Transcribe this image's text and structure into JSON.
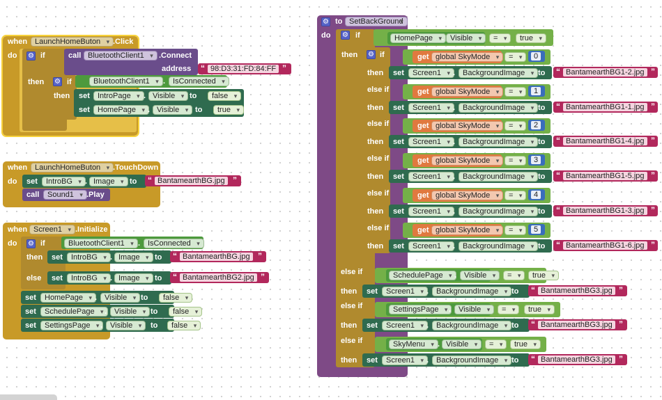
{
  "kw": {
    "when": "when",
    "do": "do",
    "if": "if",
    "then": "then",
    "else": "else",
    "else_if": "else if",
    "set": "set",
    "call": "call",
    "get": "get",
    "to": "to",
    "eq": "=",
    "dot_click": ".Click",
    "dot_touchdown": ".TouchDown",
    "dot_initialize": ".Initialize",
    "dot_connect": ".Connect",
    "dot_play": ".Play",
    "address": "address",
    "quote_open": "“",
    "quote_close": "”",
    "dot": "."
  },
  "blocks": {
    "launch_click": {
      "component": "LaunchHomeButon",
      "call_component": "BluetoothClient1",
      "address_value": "98:D3:31:FD:84:FF",
      "inner_component": "BluetoothClient1",
      "inner_prop": "IsConnected",
      "set1_component": "IntroPage",
      "set1_prop": "Visible",
      "set1_value": "false",
      "set2_component": "HomePage",
      "set2_prop": "Visible",
      "set2_value": "true"
    },
    "launch_touchdown": {
      "component": "LaunchHomeButon",
      "set_component": "IntroBG",
      "set_prop": "Image",
      "set_value": "BantamearthBG.jpg",
      "call_component": "Sound1"
    },
    "screen_init": {
      "component": "Screen1",
      "if_component": "BluetoothClient1",
      "if_prop": "IsConnected",
      "then_component": "IntroBG",
      "then_prop": "Image",
      "then_value": "BantamearthBG.jpg",
      "else_component": "IntroBG",
      "else_prop": "Image",
      "else_value": "BantamearthBG2.jpg",
      "sets": [
        {
          "component": "HomePage",
          "prop": "Visible",
          "value": "false"
        },
        {
          "component": "SchedulePage",
          "prop": "Visible",
          "value": "false"
        },
        {
          "component": "SettingsPage",
          "prop": "Visible",
          "value": "false"
        }
      ]
    },
    "set_background": {
      "proc_label": "to",
      "proc_name": "SetBackGround",
      "outer_if": {
        "component": "HomePage",
        "prop": "Visible",
        "value": "true"
      },
      "sky_var": "global SkyMode",
      "sky_cases": [
        {
          "num": "0",
          "component": "Screen1",
          "prop": "BackgroundImage",
          "image": "BantamearthBG1-2.jpg"
        },
        {
          "num": "1",
          "component": "Screen1",
          "prop": "BackgroundImage",
          "image": "BantamearthBG1-1.jpg"
        },
        {
          "num": "2",
          "component": "Screen1",
          "prop": "BackgroundImage",
          "image": "BantamearthBG1-4.jpg"
        },
        {
          "num": "3",
          "component": "Screen1",
          "prop": "BackgroundImage",
          "image": "BantamearthBG1-5.jpg"
        },
        {
          "num": "4",
          "component": "Screen1",
          "prop": "BackgroundImage",
          "image": "BantamearthBG1-3.jpg"
        },
        {
          "num": "5",
          "component": "Screen1",
          "prop": "BackgroundImage",
          "image": "BantamearthBG1-6.jpg"
        }
      ],
      "page_cases": [
        {
          "component": "SchedulePage",
          "prop": "Visible",
          "value": "true",
          "set_component": "Screen1",
          "set_prop": "BackgroundImage",
          "image": "BantamearthBG3.jpg"
        },
        {
          "component": "SettingsPage",
          "prop": "Visible",
          "value": "true",
          "set_component": "Screen1",
          "set_prop": "BackgroundImage",
          "image": "BantamearthBG3.jpg"
        },
        {
          "component": "SkyMenu",
          "prop": "Visible",
          "value": "true",
          "set_component": "Screen1",
          "set_prop": "BackgroundImage",
          "image": "BantamearthBG3.jpg"
        }
      ]
    }
  },
  "colors": {
    "event": "#c89a28",
    "selected_outline": "#f7d23c",
    "procedure": "#7e4a86",
    "setter": "#2f6b4f",
    "string": "#b2285c",
    "number": "#3a6dbb",
    "get": "#e0793f"
  }
}
